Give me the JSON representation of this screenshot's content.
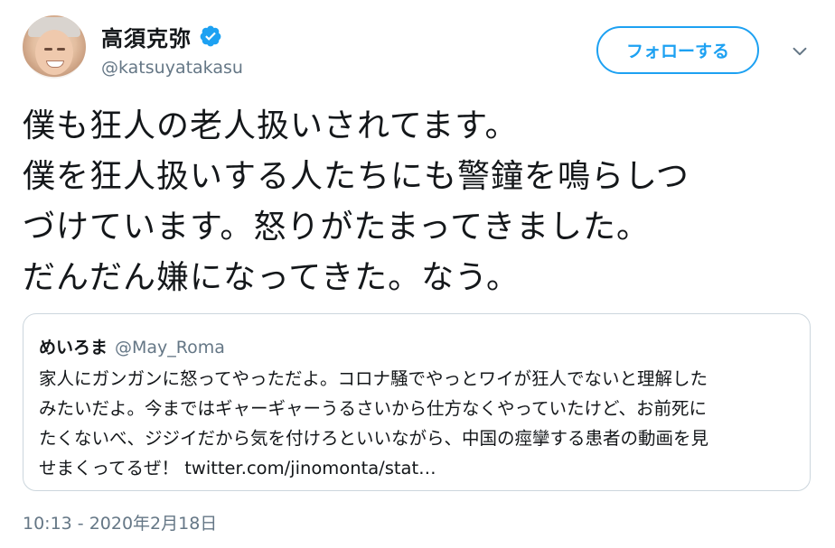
{
  "author": {
    "display_name": "高須克弥",
    "handle": "@katsuyatakasu",
    "verified_icon": "verified-badge-icon",
    "avatar_icon": "profile-photo"
  },
  "follow_button": {
    "label": "フォローする"
  },
  "menu": {
    "icon": "chevron-down-icon"
  },
  "tweet": {
    "lines": [
      "僕も狂人の老人扱いされてます。",
      "僕を狂人扱いする人たちにも警鐘を鳴らしつ",
      "づけています。怒りがたまってきました。",
      "だんだん嫌になってきた。なう。"
    ]
  },
  "quoted_tweet": {
    "name": "めいろま",
    "handle": "@May_Roma",
    "lines": [
      "家人にガンガンに怒ってやっただよ。コロナ騒でやっとワイが狂人でないと理解した",
      "みたいだよ。今まではギャーギャーうるさいから仕方なくやっていたけど、お前死に",
      "たくないべ、ジジイだから気を付けろといいながら、中国の痙攣する患者の動画を見",
      "せまくってるぜ！ twitter.com/jinomonta/stat…"
    ]
  },
  "timestamp": "10:13 - 2020年2月18日",
  "colors": {
    "accent": "#1da1f2",
    "text": "#14171a",
    "secondary_text": "#657786",
    "border": "#ccd6dd"
  }
}
